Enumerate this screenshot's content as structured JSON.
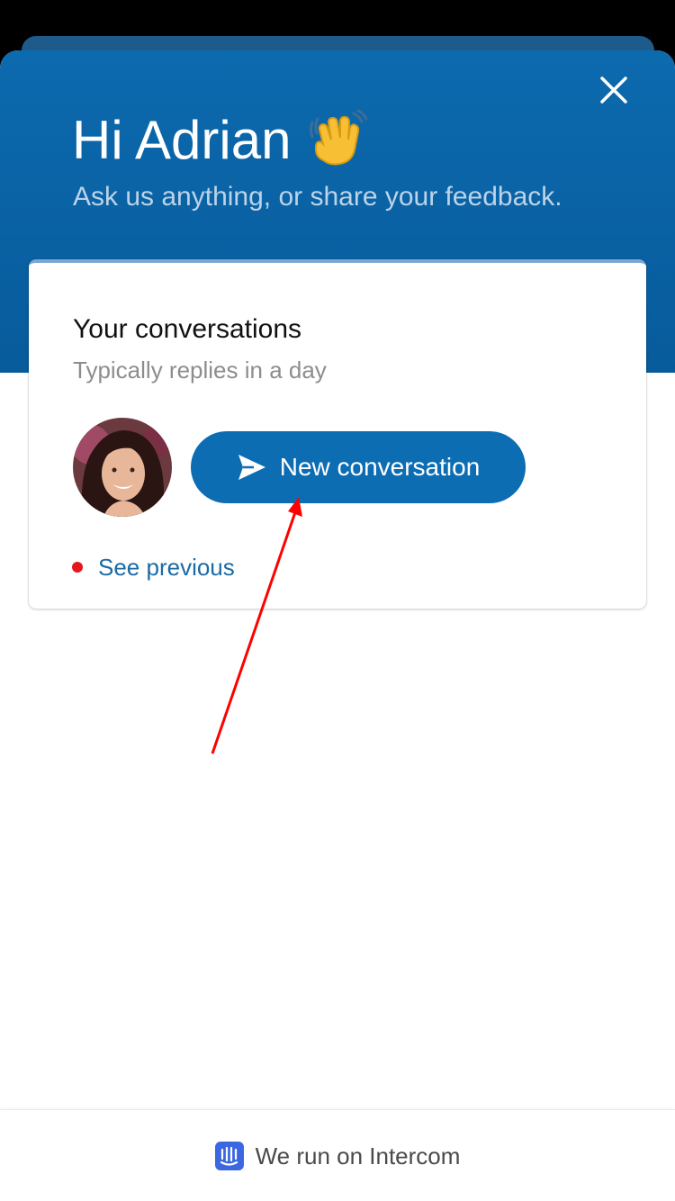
{
  "header": {
    "greeting": "Hi Adrian",
    "greeting_emoji_icon": "waving-hand-icon",
    "subtitle": "Ask us anything, or share your feedback.",
    "close_icon": "close-icon",
    "background_color": "#0c6aae"
  },
  "card": {
    "title": "Your conversations",
    "subtitle": "Typically replies in a day",
    "avatar_icon": "team-member-avatar",
    "new_conversation_label": "New conversation",
    "new_conversation_icon": "send-icon",
    "button_color": "#0d6db3",
    "see_previous_label": "See previous",
    "unread_indicator_color": "#e4171b"
  },
  "annotation": {
    "type": "red-arrow",
    "color": "#ff0000",
    "points_to": "new-conversation-button"
  },
  "footer": {
    "text": "We run on Intercom",
    "icon": "intercom-icon"
  }
}
